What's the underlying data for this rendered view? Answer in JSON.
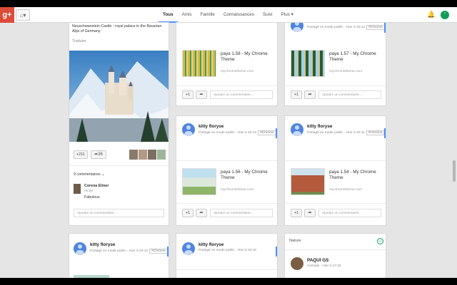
{
  "header": {
    "logo": "g+",
    "home_caret": "▾",
    "nav": [
      "Tous",
      "Amis",
      "Famille",
      "Connaissances",
      "Suivi",
      "Plus"
    ],
    "nav_more_caret": "▾"
  },
  "featured": {
    "caption": "Neuschwanstein Castle - royal palace in the Bavarian Alps of Germany.",
    "translate": "Traduire",
    "plus_count": "+211",
    "share_count": "36",
    "comments_count": "9 commentaires",
    "comment": {
      "author": "Corena Elmer",
      "time": "02:56",
      "text": "Fabulous"
    },
    "comment_placeholder": "Ajoutez un commentaire..."
  },
  "cards": [
    {
      "title": "paya 1.58 - My Chrome Theme",
      "source": "mychrometheme.com"
    },
    {
      "title": "paya 1.57 - My Chrome Theme",
      "source": "mychrometheme.com",
      "meta": "Partagé en mode public - Hier à 20:14",
      "tag": "#Chrome"
    },
    {
      "author": "kitty floryse",
      "meta": "Partagé en mode public - Hier à 20:13",
      "tag": "#Chrome",
      "title": "paya 1.56 - My Chrome Theme",
      "source": "mychrometheme.com"
    },
    {
      "author": "kitty floryse",
      "meta": "Partagé en mode public - Hier à 20:11",
      "tag": "#Chrome",
      "title": "paya 1.54 - My Chrome Theme",
      "source": "mychrometheme.com"
    },
    {
      "author": "kitty floryse",
      "meta": "Partagé en mode public - Hier à 20:12",
      "tag": "#Chrome"
    },
    {
      "author": "kitty floryse",
      "meta": "Partagé en mode public - Hier à 20:10"
    }
  ],
  "plus_one": "+1",
  "comment_placeholder": "Ajoutez un commentaire...",
  "nature": {
    "label": "Nature",
    "author": "PAQUI GS",
    "meta": "Animals - Hier à 17:43"
  },
  "colors": {
    "brand": "#dd4b39",
    "accent": "#4d90fe"
  }
}
